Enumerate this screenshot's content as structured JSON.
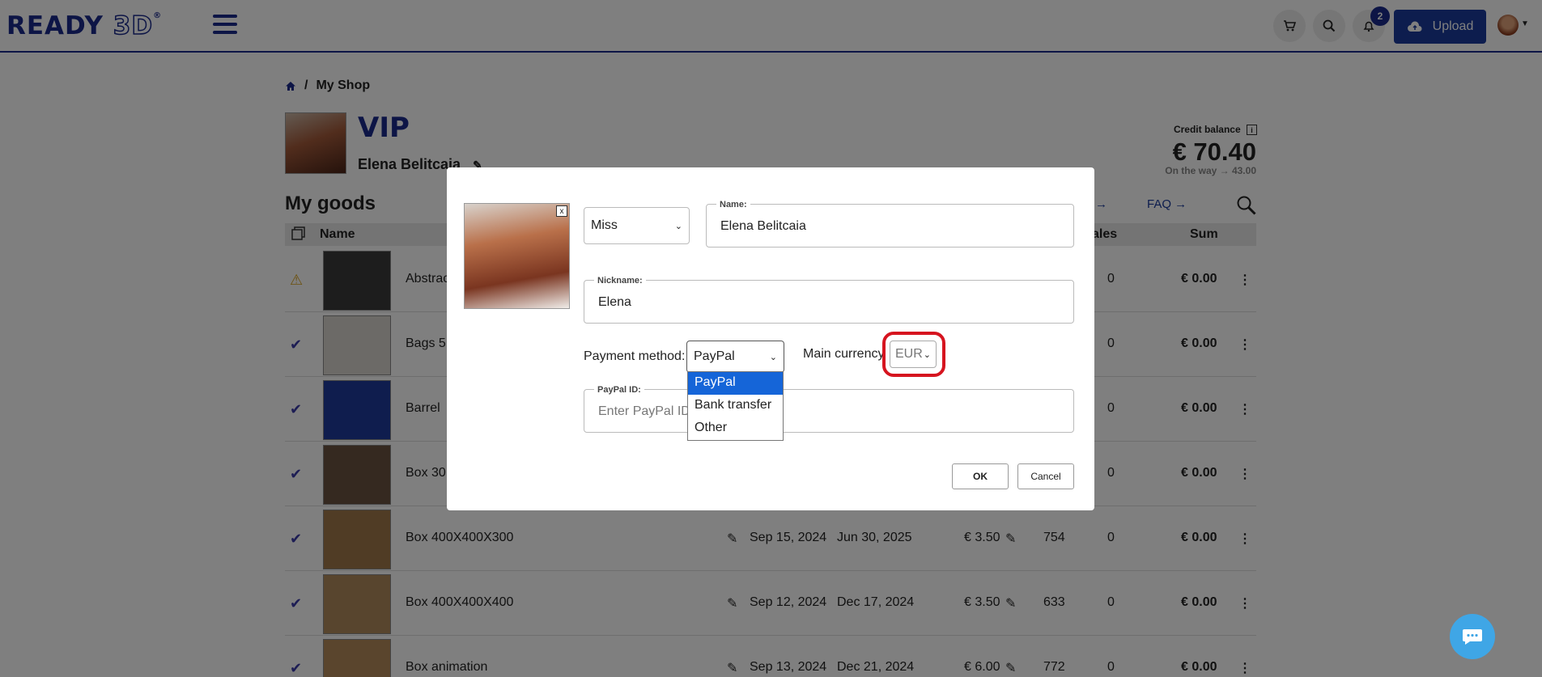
{
  "header": {
    "logo_main": "READY",
    "logo_accent": "3D",
    "logo_mark": "®",
    "notification_count": "2",
    "upload_label": "Upload"
  },
  "breadcrumb": {
    "home_icon": "home-icon",
    "separator": "/",
    "current": "My Shop"
  },
  "profile": {
    "badge": "VIP",
    "name": "Elena Belitcaia"
  },
  "credit": {
    "label": "Credit balance",
    "value": "€ 70.40",
    "on_the_way": "On the way → 43.00"
  },
  "goods": {
    "title": "My goods",
    "faq": "FAQ →",
    "arrow": "→",
    "columns": {
      "name": "Name",
      "sales": "ales",
      "sum": "Sum"
    },
    "rows": [
      {
        "name": "Abstrac",
        "status": "warning",
        "c1": "",
        "c2": "",
        "price": "",
        "views": "",
        "sales": "0",
        "sum": "€ 0.00"
      },
      {
        "name": "Bags 5",
        "status": "check",
        "c1": "",
        "c2": "",
        "price": "",
        "views": "",
        "sales": "0",
        "sum": "€ 0.00"
      },
      {
        "name": "Barrel",
        "status": "check",
        "c1": "",
        "c2": "",
        "price": "",
        "views": "",
        "sales": "0",
        "sum": "€ 0.00"
      },
      {
        "name": "Box 30",
        "status": "check",
        "c1": "",
        "c2": "",
        "price": "",
        "views": "",
        "sales": "0",
        "sum": "€ 0.00"
      },
      {
        "name": "Box 400X400X300",
        "status": "check",
        "c1": "Sep 15, 2024",
        "c2": "Jun 30, 2025",
        "price": "€ 3.50",
        "views": "754",
        "sales": "0",
        "sum": "€ 0.00"
      },
      {
        "name": "Box 400X400X400",
        "status": "check",
        "c1": "Sep 12, 2024",
        "c2": "Dec 17, 2024",
        "price": "€ 3.50",
        "views": "633",
        "sales": "0",
        "sum": "€ 0.00"
      },
      {
        "name": "Box animation",
        "status": "check",
        "c1": "Sep 13, 2024",
        "c2": "Dec 21, 2024",
        "price": "€ 6.00",
        "views": "772",
        "sales": "0",
        "sum": "€ 0.00"
      }
    ]
  },
  "modal": {
    "close": "x",
    "title_select": "Miss",
    "name_label": "Name:",
    "name_value": "Elena Belitcaia",
    "nickname_label": "Nickname:",
    "nickname_value": "Elena",
    "payment_label": "Payment method:",
    "payment_value": "PayPal",
    "payment_options": [
      "PayPal",
      "Bank transfer",
      "Other"
    ],
    "currency_label": "Main currency",
    "currency_value": "EUR",
    "paypal_label": "PayPal ID:",
    "paypal_placeholder": "Enter PayPal ID (",
    "ok": "OK",
    "cancel": "Cancel"
  },
  "colors": {
    "brand": "#1a2a8c",
    "upload": "#1a3a9c",
    "highlight": "#d6141f",
    "selected_option": "#1565d8",
    "chat": "#3fa6e6"
  }
}
